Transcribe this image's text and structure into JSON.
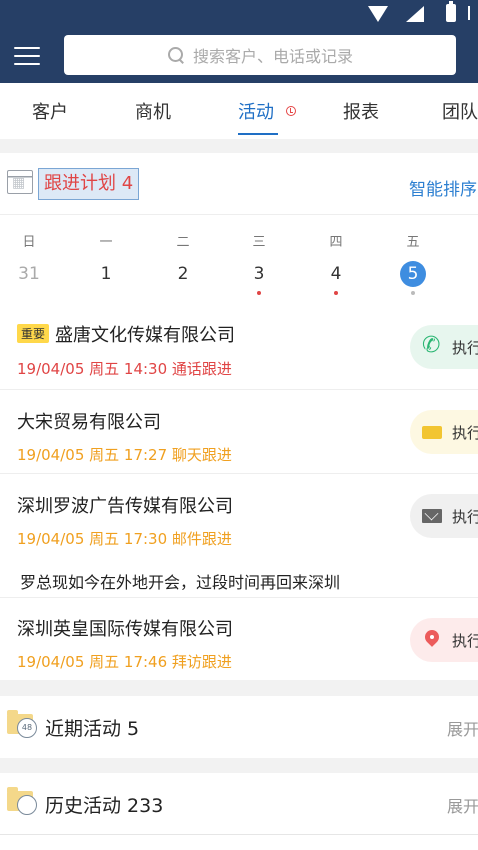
{
  "search": {
    "placeholder": "搜索客户、电话或记录"
  },
  "tabs": [
    {
      "label": "客户"
    },
    {
      "label": "商机"
    },
    {
      "label": "活动",
      "active": true
    },
    {
      "label": "报表"
    },
    {
      "label": "团队"
    }
  ],
  "plan": {
    "title": "跟进计划 4",
    "smart_sort": "智能排序"
  },
  "week": {
    "labels": [
      "日",
      "一",
      "二",
      "三",
      "四",
      "五"
    ],
    "dates": [
      "31",
      "1",
      "2",
      "3",
      "4",
      "5"
    ],
    "selected_index": 5
  },
  "items": [
    {
      "important_badge": "重要",
      "title": "盛唐文化传媒有限公司",
      "meta": "19/04/05 周五 14:30 通话跟进",
      "exec": "执行",
      "icon": "phone-icon"
    },
    {
      "title": "大宋贸易有限公司",
      "meta": "19/04/05 周五 17:27 聊天跟进",
      "exec": "执行",
      "icon": "chat-icon"
    },
    {
      "title": "深圳罗波广告传媒有限公司",
      "meta": "19/04/05 周五 17:30 邮件跟进",
      "exec": "执行",
      "icon": "mail-icon",
      "note": "罗总现如今在外地开会，过段时间再回来深圳"
    },
    {
      "title": "深圳英皇国际传媒有限公司",
      "meta": "19/04/05 周五 17:46 拜访跟进",
      "exec": "执行",
      "icon": "location-pin-icon"
    }
  ],
  "sections": [
    {
      "title": "近期活动 5",
      "expand": "展开",
      "clock_label": "48"
    },
    {
      "title": "历史活动 233",
      "expand": "展开"
    }
  ],
  "colors": {
    "header": "#263f66",
    "accent": "#1f6fc5",
    "red": "#e04545",
    "orange": "#f0a020"
  }
}
